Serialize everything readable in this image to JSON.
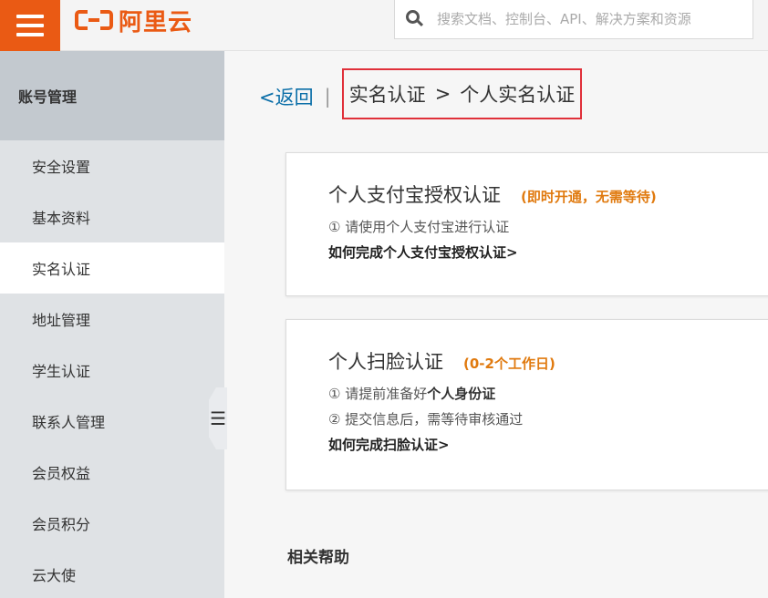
{
  "topbar": {
    "logo_text": "阿里云",
    "menu_icon": "hamburger-menu-icon",
    "search": {
      "icon": "search-icon",
      "placeholder": "搜索文档、控制台、API、解决方案和资源"
    },
    "colors": {
      "brand": "#ea5a14"
    }
  },
  "sidebar": {
    "header": "账号管理",
    "items": [
      {
        "label": "安全设置"
      },
      {
        "label": "基本资料"
      },
      {
        "label": "实名认证",
        "active": true
      },
      {
        "label": "地址管理"
      },
      {
        "label": "学生认证"
      },
      {
        "label": "联系人管理"
      },
      {
        "label": "会员权益"
      },
      {
        "label": "会员积分"
      },
      {
        "label": "云大使"
      }
    ],
    "collapse_icon": "menu-collapse-icon"
  },
  "breadcrumb": {
    "back": "<返回",
    "separator": "|",
    "current": "实名认证",
    "arrow": ">",
    "sub": "个人实名认证",
    "highlight_color": "#e0303a"
  },
  "cards": [
    {
      "title": "个人支付宝授权认证",
      "note": "(即时开通，无需等待)",
      "lines": [
        "① 请使用个人支付宝进行认证"
      ],
      "link": "如何完成个人支付宝授权认证>"
    },
    {
      "title": "个人扫脸认证",
      "note": "(0-2个工作日)",
      "line1_prefix": "① 请提前准备好",
      "line1_bold": "个人身份证",
      "line2": "② 提交信息后，需等待审核通过",
      "link": "如何完成扫脸认证>"
    }
  ],
  "help": {
    "title": "相关帮助"
  },
  "accent_colors": {
    "link": "#0a6ea8",
    "note": "#e07a0f"
  }
}
